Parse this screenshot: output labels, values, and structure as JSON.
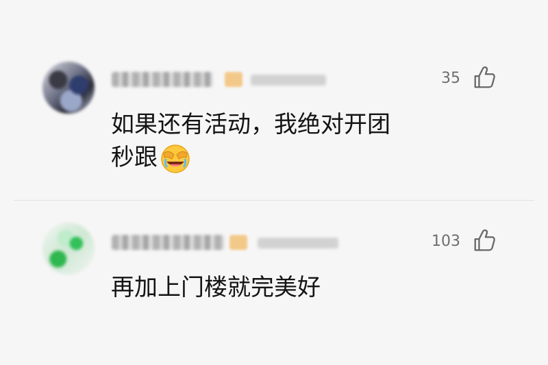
{
  "comments": [
    {
      "likes": "35",
      "line1": "如果还有活动，我绝对开团",
      "line2": "秒跟",
      "emoji": "laughing-face-emoji"
    },
    {
      "likes": "103",
      "line1": "再加上门楼就完美好"
    }
  ],
  "colors": {
    "background": "#f6f6f6",
    "text": "#141414",
    "like_count": "#6d6d6d",
    "divider": "#e2e2e2"
  }
}
